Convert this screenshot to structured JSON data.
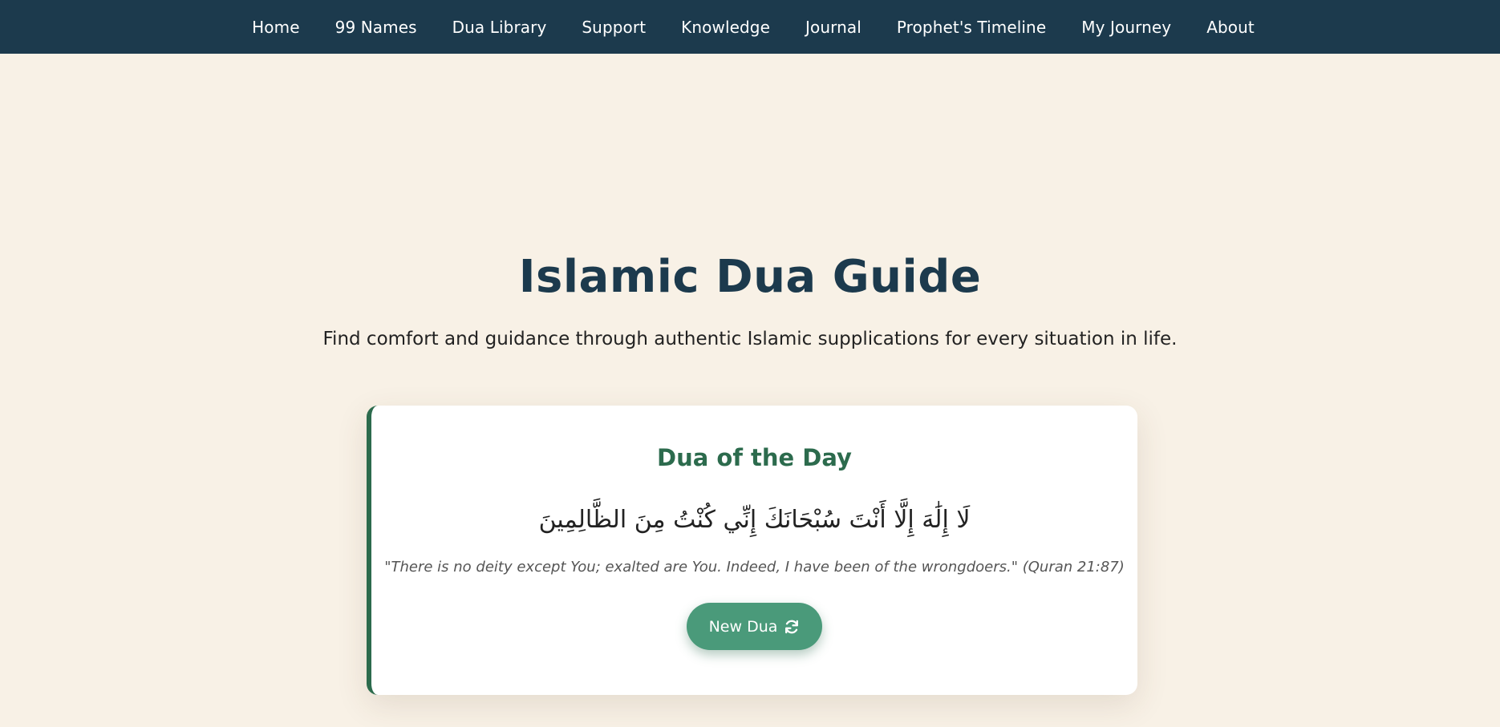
{
  "nav": {
    "items": [
      {
        "label": "Home"
      },
      {
        "label": "99 Names"
      },
      {
        "label": "Dua Library"
      },
      {
        "label": "Support"
      },
      {
        "label": "Knowledge"
      },
      {
        "label": "Journal"
      },
      {
        "label": "Prophet's Timeline"
      },
      {
        "label": "My Journey"
      },
      {
        "label": "About"
      }
    ]
  },
  "hero": {
    "title": "Islamic Dua Guide",
    "subtitle": "Find comfort and guidance through authentic Islamic supplications for every situation in life."
  },
  "dua_card": {
    "title": "Dua of the Day",
    "arabic": "لَا إِلَٰهَ إِلَّا أَنْتَ سُبْحَانَكَ إِنِّي كُنْتُ مِنَ الظَّالِمِينَ",
    "translation": "\"There is no deity except You; exalted are You. Indeed, I have been of the wrongdoers.\" (Quran 21:87)",
    "button_label": "New Dua",
    "button_icon": "refresh-icon"
  },
  "colors": {
    "nav_bg": "#1c3a4d",
    "page_bg": "#f8f1e6",
    "accent_green": "#2c6b4d",
    "button_green": "#4a9a7a"
  }
}
